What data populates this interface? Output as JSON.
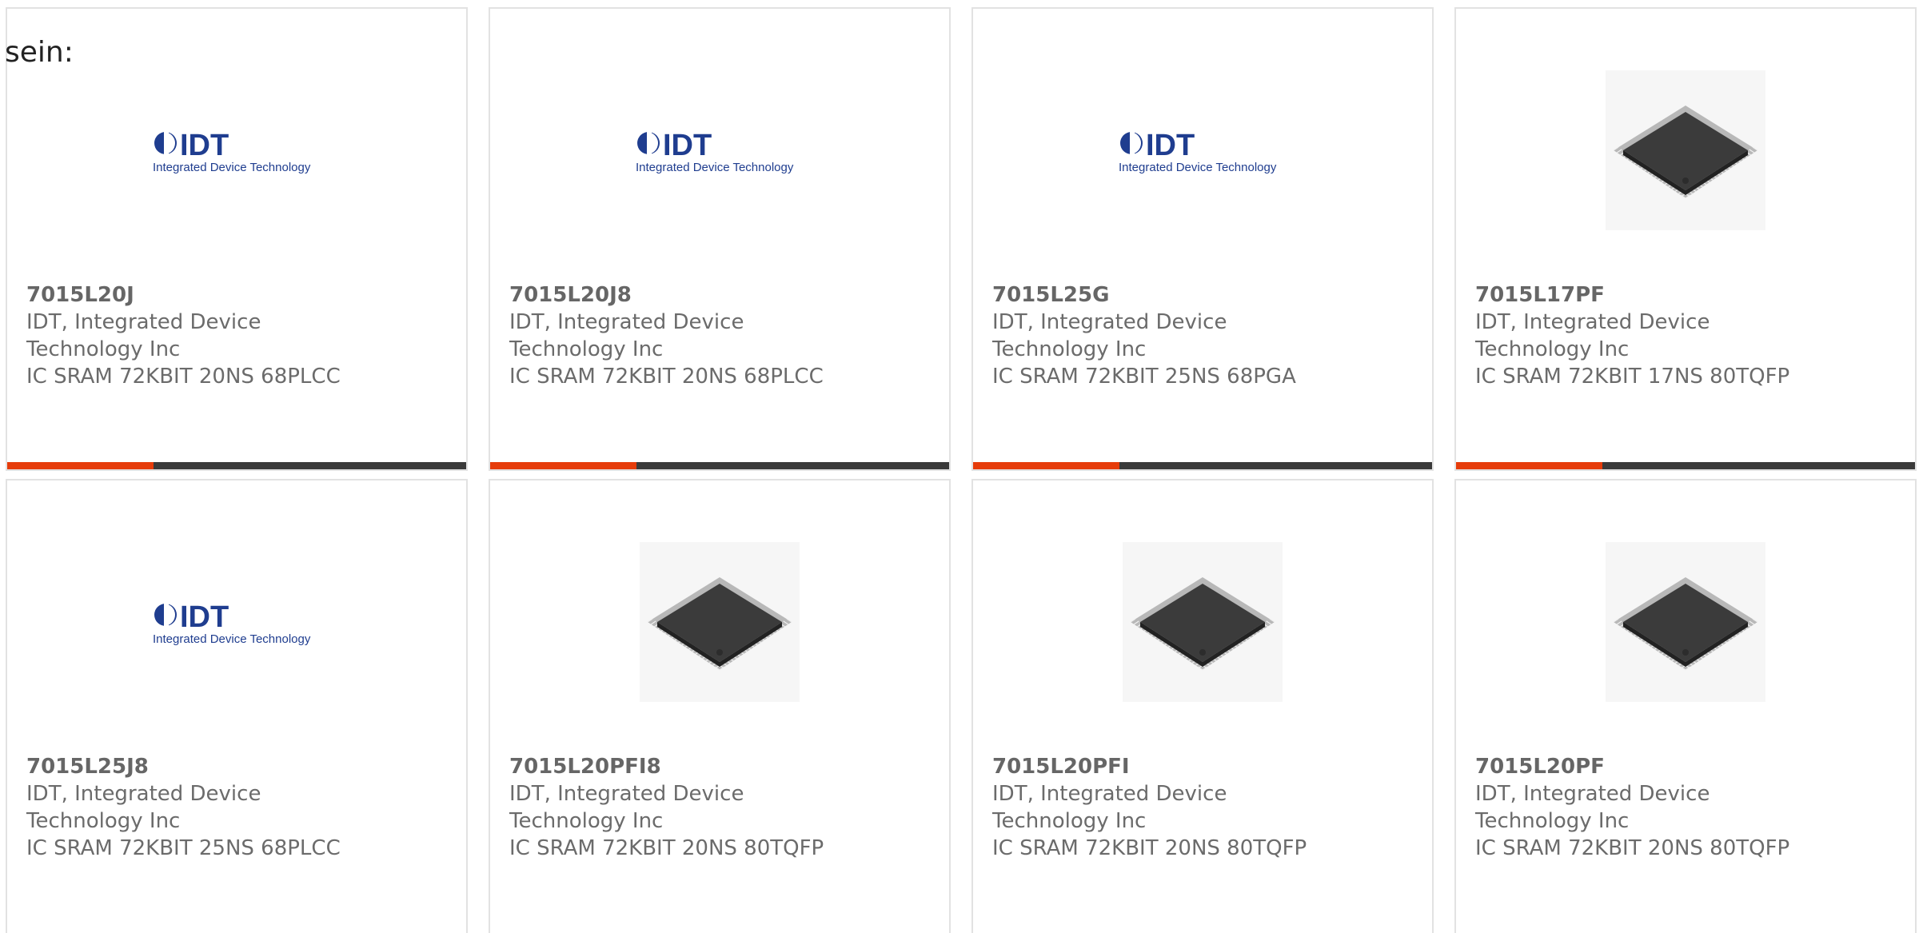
{
  "intro_text": "sein:",
  "colors": {
    "accent": "#e63c0a",
    "bar_dark": "#3a3a3a",
    "logo_blue": "#1f3d8f",
    "chip": "#3b3b3b"
  },
  "logo": {
    "brand": "IDT",
    "tagline": "Integrated Device Technology"
  },
  "products": [
    {
      "part": "7015L20J",
      "manufacturer": "IDT, Integrated Device Technology Inc",
      "description": "IC SRAM 72KBIT 20NS 68PLCC",
      "image": "idt-logo"
    },
    {
      "part": "7015L20J8",
      "manufacturer": "IDT, Integrated Device Technology Inc",
      "description": "IC SRAM 72KBIT 20NS 68PLCC",
      "image": "idt-logo"
    },
    {
      "part": "7015L25G",
      "manufacturer": "IDT, Integrated Device Technology Inc",
      "description": "IC SRAM 72KBIT 25NS 68PGA",
      "image": "idt-logo"
    },
    {
      "part": "7015L17PF",
      "manufacturer": "IDT, Integrated Device Technology Inc",
      "description": "IC SRAM 72KBIT 17NS 80TQFP",
      "image": "chip"
    },
    {
      "part": "7015L25J8",
      "manufacturer": "IDT, Integrated Device Technology Inc",
      "description": "IC SRAM 72KBIT 25NS 68PLCC",
      "image": "idt-logo"
    },
    {
      "part": "7015L20PFI8",
      "manufacturer": "IDT, Integrated Device Technology Inc",
      "description": "IC SRAM 72KBIT 20NS 80TQFP",
      "image": "chip"
    },
    {
      "part": "7015L20PFI",
      "manufacturer": "IDT, Integrated Device Technology Inc",
      "description": "IC SRAM 72KBIT 20NS 80TQFP",
      "image": "chip"
    },
    {
      "part": "7015L20PF",
      "manufacturer": "IDT, Integrated Device Technology Inc",
      "description": "IC SRAM 72KBIT 20NS 80TQFP",
      "image": "chip"
    }
  ]
}
